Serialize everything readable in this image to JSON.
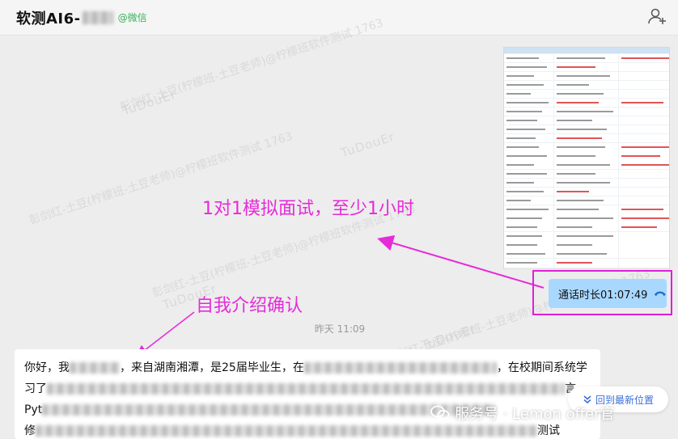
{
  "header": {
    "title": "软测AI6-",
    "tag": "@微信",
    "add_member_icon": "add-user-icon"
  },
  "watermark": {
    "line1": "彭剑红-土豆(柠檬班-土豆老师)@柠檬班软件测试 1763",
    "line2": "TuDouEr"
  },
  "call": {
    "text": "通话时长01:07:49",
    "icon": "phone-hangup-icon"
  },
  "annotations": {
    "mock_interview": "1对1模拟面试，至少1小时",
    "self_intro": "自我介绍确认"
  },
  "timestamp": "昨天 11:09",
  "message": {
    "line1_a": "你好，我",
    "line1_b": "，来自湖南湘潭，是25届毕业生，在",
    "line1_c": "，在校期间系统学",
    "line2_a": "习了",
    "line2_b": "言",
    "line3_a": "Pyt",
    "line4_a": "修",
    "line4_b": "测试"
  },
  "jump_button": {
    "label": "回到最新位置",
    "icon": "double-chevron-down-icon"
  },
  "source_mark": {
    "text": "服务号 · Lemon offer官",
    "icon": "wechat-logo-icon"
  },
  "colors": {
    "annotation": "#e62bd9",
    "call_bubble": "#a9d8ff",
    "link": "#3b6fd8",
    "wechat_green": "#36b35a"
  }
}
